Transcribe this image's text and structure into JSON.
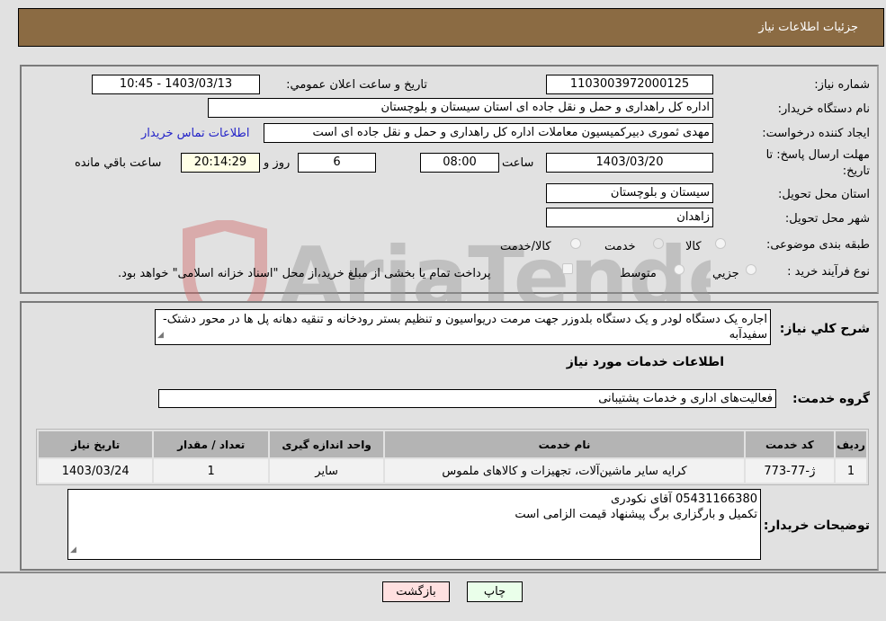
{
  "header": {
    "title": "جزئیات اطلاعات نیاز"
  },
  "fields": {
    "need_number": {
      "label": "شماره نیاز:",
      "value": "1103003972000125"
    },
    "announce_datetime": {
      "label": "تاریخ و ساعت اعلان عمومي:",
      "value": "1403/03/13 - 10:45"
    },
    "buyer_org": {
      "label": "نام دستگاه خریدار:",
      "value": "اداره کل راهداری و حمل و نقل جاده ای استان سیستان و بلوچستان"
    },
    "requester": {
      "label": "ایجاد کننده درخواست:",
      "value": "مهدی ثموری دبیرکمیسیون معاملات اداره کل راهداری و حمل و نقل جاده ای است",
      "contact_link": "اطلاعات تماس خریدار"
    },
    "deadline": {
      "label_line1": "مهلت ارسال پاسخ: تا",
      "label_line2": "تاریخ:",
      "date": "1403/03/20",
      "time_label": "ساعت",
      "time": "08:00",
      "days": "6",
      "days_label": "روز و",
      "remaining": "20:14:29",
      "remaining_label": "ساعت باقي مانده"
    },
    "province": {
      "label": "استان محل تحویل:",
      "value": "سیستان و بلوچستان"
    },
    "city": {
      "label": "شهر محل تحویل:",
      "value": "زاهدان"
    },
    "category": {
      "label": "طبقه بندی موضوعی:",
      "options": [
        "کالا",
        "خدمت",
        "کالا/خدمت"
      ],
      "selected": "خدمت"
    },
    "purchase_process": {
      "label": "نوع فرآیند خرید :",
      "options": [
        "جزيي",
        "متوسط"
      ],
      "treasury_note": "پرداخت تمام یا بخشی از مبلغ خرید،از محل \"اسناد خزانه اسلامی\" خواهد بود."
    }
  },
  "description": {
    "label": "شرح کلي نیاز:",
    "value": "اجاره یک دستگاه لودر و یک دستگاه بلدوزر جهت مرمت دریواسیون و تنظیم بستر رودخانه و تنقیه دهانه پل ها در محور دشتک-سفیدآبه"
  },
  "services_section": {
    "title": "اطلاعات خدمات مورد نیاز",
    "group_label": "گروه خدمت:",
    "group_value": "فعالیت‌های اداری و خدمات پشتیبانی",
    "table": {
      "headers": [
        "ردیف",
        "کد خدمت",
        "نام خدمت",
        "واحد اندازه گیری",
        "تعداد / مقدار",
        "تاریخ نیاز"
      ],
      "rows": [
        [
          "1",
          "ژ-77-773",
          "کرایه سایر ماشین‌آلات، تجهیزات و کالاهای ملموس",
          "سایر",
          "1",
          "1403/03/24"
        ]
      ]
    }
  },
  "buyer_notes": {
    "label": "توضیحات خریدار:",
    "line1": "05431166380 آقای نکودری",
    "line2": "تکمیل و بارگزاری برگ پیشنهاد قیمت الزامی است"
  },
  "buttons": {
    "print": "چاپ",
    "back": "بازگشت"
  },
  "watermark": {
    "text": "AriaTender.neT"
  },
  "colors": {
    "header_bg": "#8b6b43",
    "print_bg": "#eaffea",
    "back_bg": "#ffe0e0",
    "link": "#2323c8"
  }
}
